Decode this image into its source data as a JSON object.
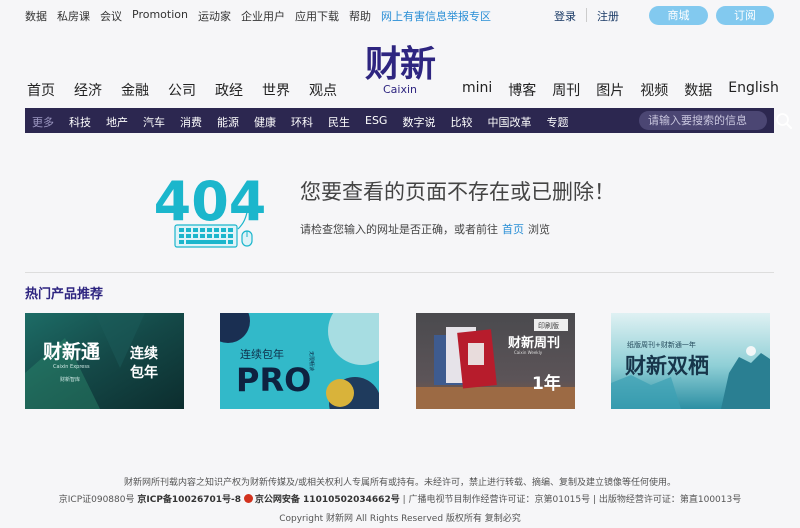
{
  "topbar": {
    "links": [
      "数据",
      "私房课",
      "会议",
      "Promotion",
      "运动家",
      "企业用户",
      "应用下载",
      "帮助"
    ],
    "report_link": "网上有害信息举报专区",
    "login": "登录",
    "register": "注册",
    "shop": "商城",
    "subscribe": "订阅"
  },
  "logo": {
    "cn": "财新",
    "en": "Caixin"
  },
  "mainnav": {
    "left": [
      "首页",
      "经济",
      "金融",
      "公司",
      "政经",
      "世界",
      "观点"
    ],
    "right": [
      "mini",
      "博客",
      "周刊",
      "图片",
      "视频",
      "数据",
      "English"
    ]
  },
  "channels": {
    "more": "更多",
    "items": [
      "科技",
      "地产",
      "汽车",
      "消费",
      "能源",
      "健康",
      "环科",
      "民生",
      "ESG",
      "数字说",
      "比较",
      "中国改革",
      "专题"
    ],
    "search_placeholder": "请输入要搜索的信息"
  },
  "error": {
    "code": "404",
    "title": "您要查看的页面不存在或已删除！",
    "hint_before": "请检查您输入的网址是否正确，或者前往",
    "home_link": "首页",
    "hint_after": "浏览"
  },
  "hot": {
    "title": "热门产品推荐",
    "cards": [
      {
        "big": "财新通",
        "small": "Caixin Express",
        "tag": "连续",
        "tag2": "包年",
        "note": "财新智库"
      },
      {
        "top": "连续包年",
        "big": "PRO",
        "side": "无限畅读"
      },
      {
        "top": "财新周刊",
        "small": "Caixin Weekly",
        "badge": "印刷版",
        "big": "1年"
      },
      {
        "top": "纸版周刊+财新通一年",
        "big": "财新双栖"
      }
    ]
  },
  "footer": {
    "line1": "财新网所刊载内容之知识产权为财新传媒及/或相关权利人专属所有或持有。未经许可，禁止进行转载、摘编、复制及建立镜像等任何使用。",
    "icp1": "京ICP证090880号",
    "icp2": "京ICP备10026701号-8",
    "police": "京公网安备 11010502034662号",
    "rest": "| 广播电视节目制作经营许可证：京第01015号 | 出版物经营许可证：第直100013号",
    "copyright": "Copyright 财新网 All Rights Reserved 版权所有 复制必究"
  },
  "colors": {
    "brand": "#2e2580",
    "accent": "#2a8fd6",
    "teal": "#1bb6cc",
    "channel_bg": "#2c2750"
  }
}
